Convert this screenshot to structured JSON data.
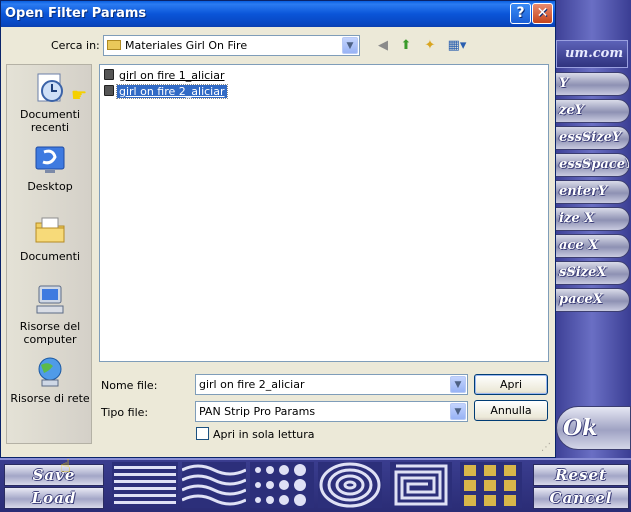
{
  "window": {
    "title": "Open Filter Params",
    "help_label": "?",
    "close_label": "✕"
  },
  "lookin": {
    "label": "Cerca in:",
    "value": "Materiales Girl On Fire"
  },
  "places": [
    {
      "label": "Documenti recenti",
      "icon": "recent-documents-icon"
    },
    {
      "label": "Desktop",
      "icon": "desktop-icon"
    },
    {
      "label": "Documenti",
      "icon": "documents-folder-icon"
    },
    {
      "label": "Risorse del computer",
      "icon": "my-computer-icon"
    },
    {
      "label": "Risorse di rete",
      "icon": "network-icon"
    }
  ],
  "files": [
    {
      "name": "girl on fire 1_aliciar",
      "selected": false
    },
    {
      "name": "girl on fire 2_aliciar",
      "selected": true
    }
  ],
  "filename": {
    "label": "Nome file:",
    "value": "girl on fire 2_aliciar"
  },
  "filetype": {
    "label": "Tipo file:",
    "value": "PAN Strip Pro Params"
  },
  "readonly": {
    "label": "Apri in sola lettura",
    "checked": false
  },
  "buttons": {
    "open": "Apri",
    "cancel": "Annulla"
  },
  "plugin": {
    "brand_fragment": "um.com",
    "side_buttons": [
      "Y",
      "zeY",
      "essSizeY",
      "essSpaceY",
      "enterY",
      "ize X",
      "ace X",
      "sSizeX",
      "paceX"
    ],
    "ok": "Ok",
    "save": "Save",
    "load": "Load",
    "reset": "Reset",
    "cancel": "Cancel"
  },
  "colors": {
    "titlebar": "#0a55d8",
    "selection": "#316ac5",
    "dialog_face": "#ece9d8",
    "plugin_bg": "#2c2f7a"
  }
}
